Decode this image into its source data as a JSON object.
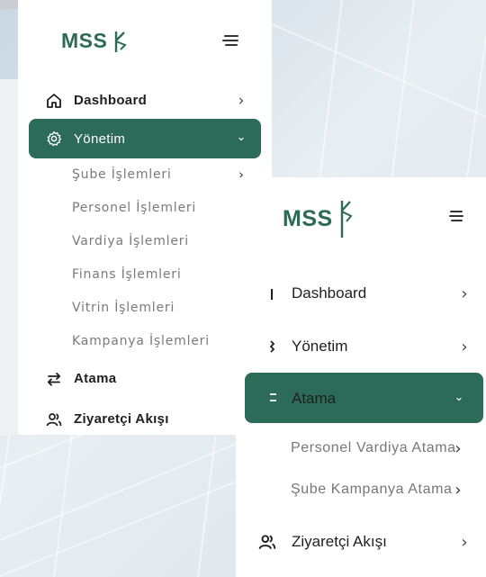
{
  "sidebar_collapsed_state_1": {
    "logo": {
      "text": "MSS",
      "icon": "mss-ribbon-icon",
      "color": "#2e6b55"
    },
    "menu_toggle_icon": "hamburger-icon",
    "items": [
      {
        "label": "Dashboard",
        "icon": "home-icon",
        "chevron": "›"
      },
      {
        "label": "Yönetim",
        "icon": "gear-icon",
        "chevron": "⌄",
        "active": true
      },
      {
        "label": "Şube İşlemleri",
        "chevron": "›"
      },
      {
        "label": "Personel İşlemleri",
        "chevron": "›"
      },
      {
        "label": "Vardiya İşlemleri",
        "chevron": "›"
      },
      {
        "label": "Finans İşlemleri",
        "chevron": "›"
      },
      {
        "label": "Vitrin İşlemleri",
        "chevron": "›"
      },
      {
        "label": "Kampanya İşlemleri",
        "chevron": "›"
      },
      {
        "label": "Atama",
        "icon": "swap-arrows-icon",
        "chevron": "›"
      },
      {
        "label": "Ziyaretçi Akışı",
        "icon": "users-icon",
        "chevron": "›"
      }
    ]
  },
  "sidebar_state_2": {
    "logo": {
      "text": "MSS",
      "icon": "mss-ribbon-icon",
      "color": "#2e6b55"
    },
    "menu_toggle_icon": "hamburger-icon",
    "items": [
      {
        "label": "Dashboard",
        "icon": "home-icon",
        "chevron": "›"
      },
      {
        "label": "Yönetim",
        "icon": "gear-icon",
        "chevron": "›"
      },
      {
        "label": "Atama",
        "icon": "swap-arrows-icon",
        "chevron": "⌄",
        "active": true
      },
      {
        "label": "Personel Vardiya Atama",
        "chevron": "›"
      },
      {
        "label": "Şube Kampanya Atama",
        "chevron": "›"
      },
      {
        "label": "Ziyaretçi Akışı",
        "icon": "users-icon",
        "chevron": "›"
      }
    ]
  },
  "colors": {
    "accent": "#2c6b57",
    "active_text": "#ffffff",
    "text": "#1f1f1f",
    "muted": "#7a7a7a"
  }
}
